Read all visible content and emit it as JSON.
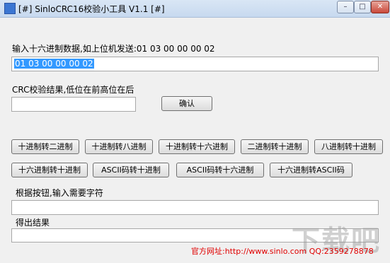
{
  "window": {
    "title": "[#] SinloCRC16校验小工具 V1.1 [#]",
    "controls": {
      "minimize": "–",
      "maximize": "□",
      "close": "✕"
    }
  },
  "hex_input": {
    "label": "输入十六进制数据,如上位机发送:01 03 00 00 00 02",
    "value": "01 03 00 00 00 02"
  },
  "crc": {
    "label": "CRC校验结果,低位在前高位在后",
    "value": "",
    "confirm_label": "确认"
  },
  "conversions": {
    "row1": [
      "十进制转二进制",
      "十进制转八进制",
      "十进制转十六进制",
      "二进制转十进制",
      "八进制转十进制"
    ],
    "row2": [
      "十六进制转十进制",
      "ASCII码转十进制",
      "ASCII码转十六进制",
      "十六进制转ASCII码"
    ]
  },
  "conversion_input": {
    "label": "根据按钮,输入需要字符",
    "value": ""
  },
  "result": {
    "label": "得出结果",
    "value": ""
  },
  "footer": {
    "text": "官方网址:http://www.sinlo.com   QQ:2359278878"
  },
  "watermark": {
    "text": "下载吧"
  },
  "colors": {
    "footer_text": "#e00000",
    "selection": "#3399ff"
  }
}
